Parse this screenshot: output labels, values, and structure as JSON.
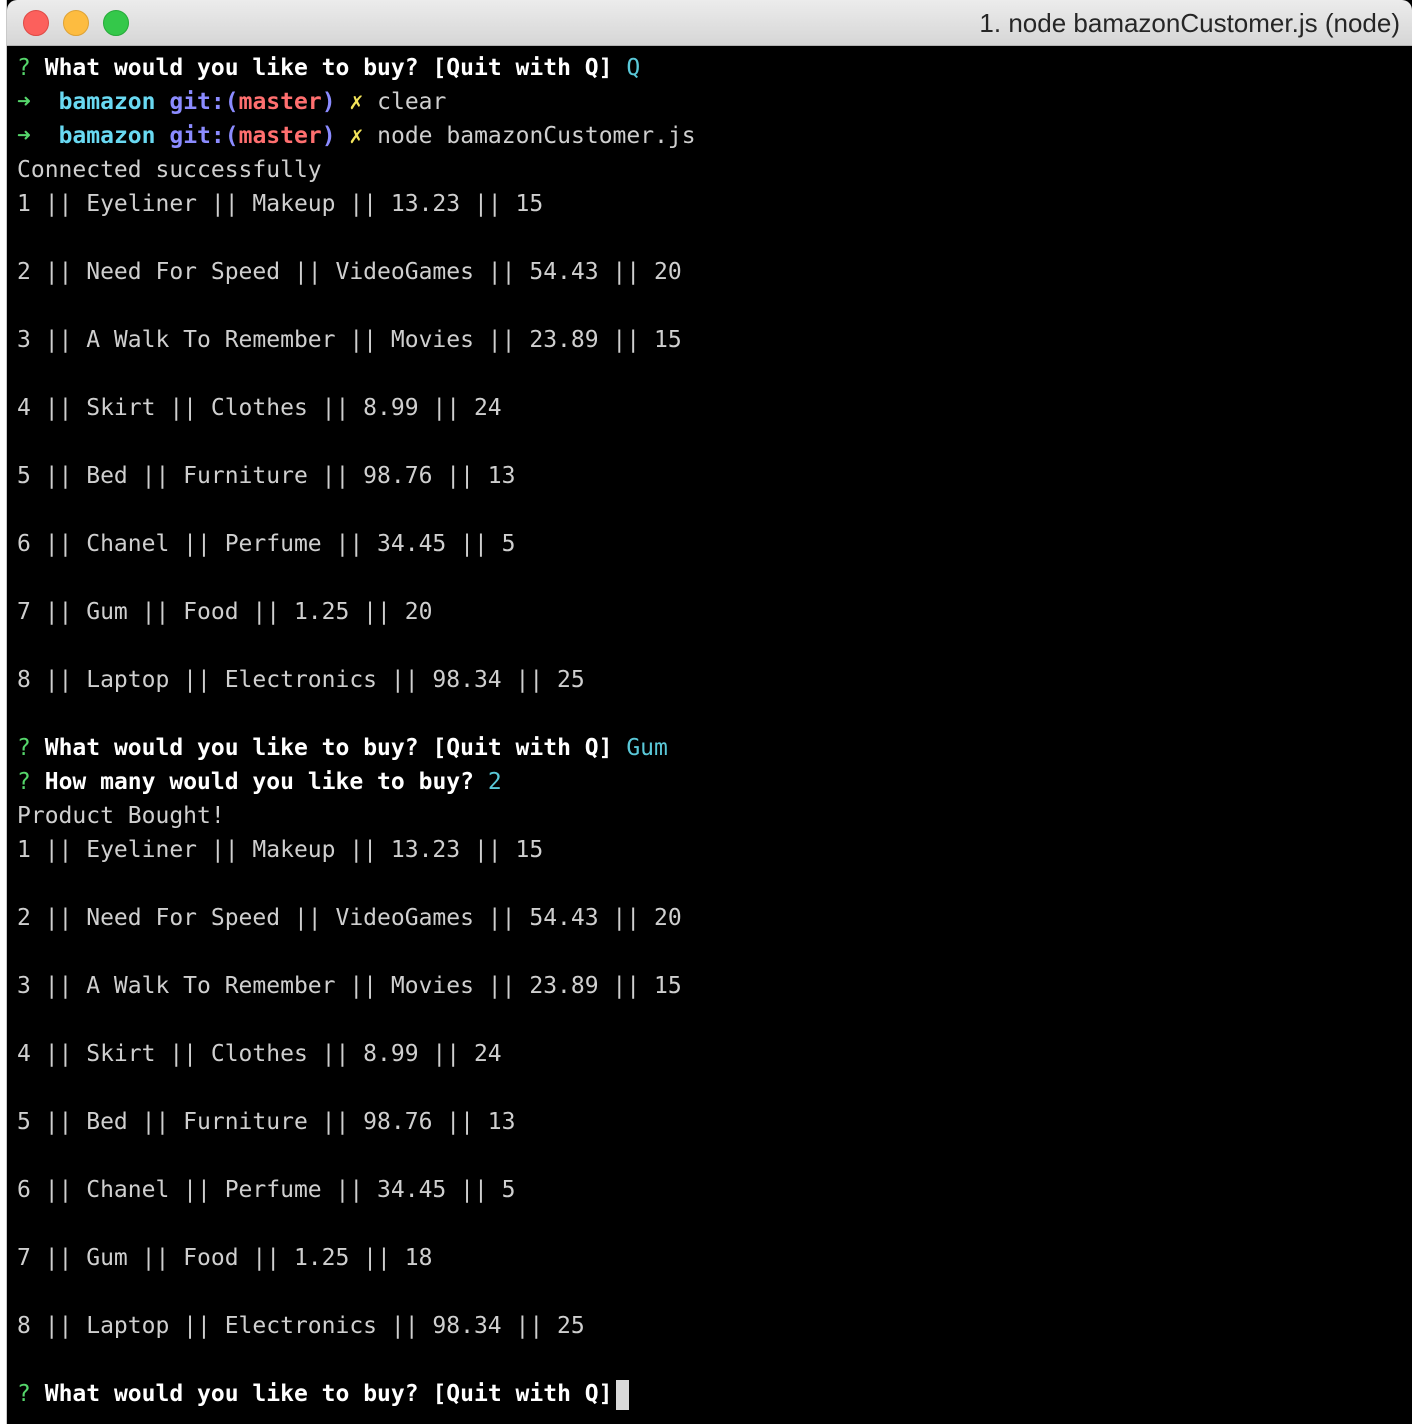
{
  "window": {
    "title": "1. node bamazonCustomer.js (node)"
  },
  "colors": {
    "prompt_green": "#55d66b",
    "answer_cyan": "#5ac8d8",
    "dir_cyan": "#69d9f2",
    "git_blue": "#8b8bff",
    "branch_red": "#ff6f6f",
    "dirty_yellow": "#f3e45a",
    "background": "#000000"
  },
  "terminal": {
    "prompt_mark": "?",
    "shell_arrow": "➜",
    "dirty_mark": "✗",
    "question_buy": "What would you like to buy? [Quit with Q]",
    "question_qty": "How many would you like to buy?",
    "first_answer": "Q",
    "dir": "bamazon",
    "git_label": "git:(",
    "branch": "master",
    "git_close": ")",
    "cmd_clear": "clear",
    "cmd_node": "node bamazonCustomer.js",
    "connected": "Connected successfully",
    "listing1": [
      "1 || Eyeliner || Makeup || 13.23 || 15",
      "2 || Need For Speed || VideoGames || 54.43 || 20",
      "3 || A Walk To Remember || Movies || 23.89 || 15",
      "4 || Skirt || Clothes || 8.99 || 24",
      "5 || Bed || Furniture || 98.76 || 13",
      "6 || Chanel || Perfume || 34.45 || 5",
      "7 || Gum || Food || 1.25 || 20",
      "8 || Laptop || Electronics || 98.34 || 25"
    ],
    "answer_product": "Gum",
    "answer_qty": "2",
    "bought": "Product Bought!",
    "listing2": [
      "1 || Eyeliner || Makeup || 13.23 || 15",
      "2 || Need For Speed || VideoGames || 54.43 || 20",
      "3 || A Walk To Remember || Movies || 23.89 || 15",
      "4 || Skirt || Clothes || 8.99 || 24",
      "5 || Bed || Furniture || 98.76 || 13",
      "6 || Chanel || Perfume || 34.45 || 5",
      "7 || Gum || Food || 1.25 || 18",
      "8 || Laptop || Electronics || 98.34 || 25"
    ]
  }
}
